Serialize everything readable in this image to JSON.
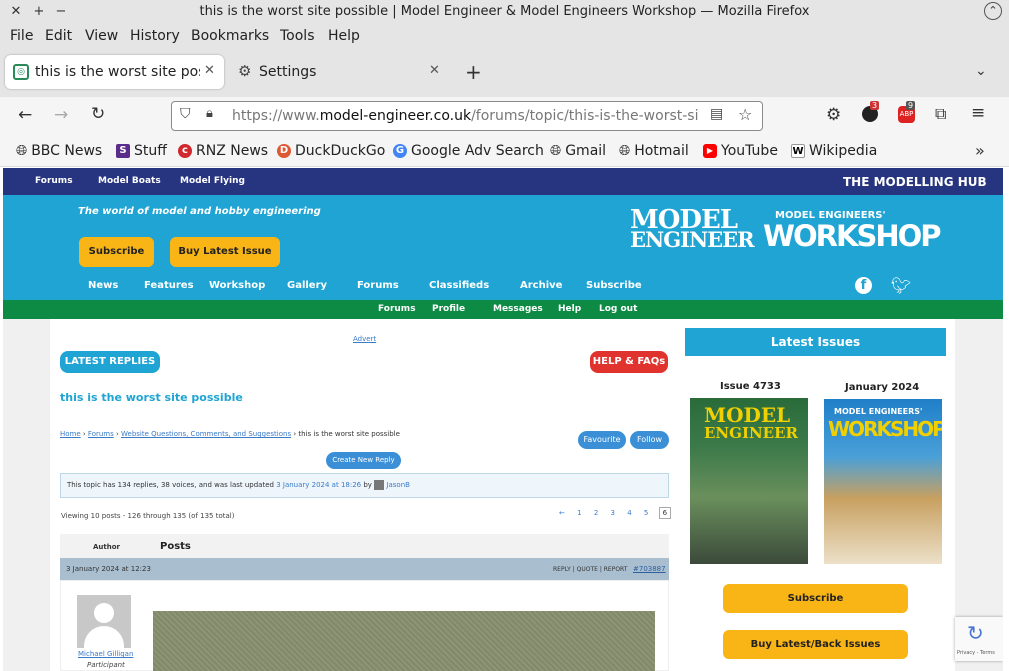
{
  "window": {
    "title": "this is the worst site possible | Model Engineer & Model Engineers Workshop — Mozilla Firefox"
  },
  "menu": [
    "File",
    "Edit",
    "View",
    "History",
    "Bookmarks",
    "Tools",
    "Help"
  ],
  "tabs": [
    {
      "label": "this is the worst site possi"
    },
    {
      "label": "Settings"
    }
  ],
  "url": {
    "prefix": "https://www.",
    "domain": "model-engineer.co.uk",
    "path": "/forums/topic/this-is-the-worst-si"
  },
  "badges": {
    "ext1": "3",
    "abp": "9"
  },
  "bookmarks": [
    "BBC News",
    "Stuff",
    "RNZ News",
    "DuckDuckGo",
    "Google Adv Search",
    "Gmail",
    "Hotmail",
    "YouTube",
    "Wikipedia"
  ],
  "site": {
    "top_links": [
      "Forums",
      "Model Boats",
      "Model Flying"
    ],
    "hub": "THE MODELLING HUB",
    "tagline": "The world of model and hobby engineering",
    "subscribe": "Subscribe",
    "buy_latest": "Buy Latest Issue",
    "logo_me": [
      "MODEL",
      "ENGINEER"
    ],
    "logo_mew_small": "MODEL ENGINEERS'",
    "logo_mew": "WORKSHOP",
    "nav": [
      "News",
      "Features",
      "Workshop",
      "Gallery",
      "Forums",
      "Classifieds",
      "Archive",
      "Subscribe"
    ],
    "subnav": [
      "Forums",
      "Profile",
      "Messages",
      "Help",
      "Log out"
    ]
  },
  "forum": {
    "advert": "Advert",
    "latest_replies": "LATEST REPLIES",
    "help": "HELP & FAQs",
    "topic_title": "this is the worst site possible",
    "breadcrumb": {
      "home": "Home",
      "forums": "Forums",
      "section": "Website Questions, Comments, and Suggestions",
      "current": "this is the worst site possible"
    },
    "favourite": "Favourite",
    "follow": "Follow",
    "create_reply": "Create New Reply",
    "info_pre": "This topic has 134 replies, 38 voices, and was last updated",
    "info_date": "3 January 2024 at 18:26",
    "info_by": "by",
    "info_user": "JasonB",
    "viewing": "Viewing 10 posts - 126 through 135 (of 135 total)",
    "pages": [
      "←",
      "1",
      "2",
      "3",
      "4",
      "5",
      "6"
    ],
    "author_hdr": "Author",
    "posts_hdr": "Posts",
    "post_date": "3 January 2024 at 12:23",
    "post_actions": "REPLY | QUOTE | REPORT",
    "post_id": "#703887",
    "post_user": "Michael Gilligan",
    "post_role": "Participant"
  },
  "sidebar": {
    "heading": "Latest Issues",
    "issue1": "Issue 4733",
    "issue2": "January 2024",
    "subscribe": "Subscribe",
    "buy": "Buy Latest/Back Issues"
  },
  "recaptcha": "Privacy - Terms",
  "colors": {
    "hub": "#273480",
    "banner": "#1fa4d4",
    "green": "#0d8a44",
    "yellow": "#f9b515",
    "red": "#e0332e"
  }
}
